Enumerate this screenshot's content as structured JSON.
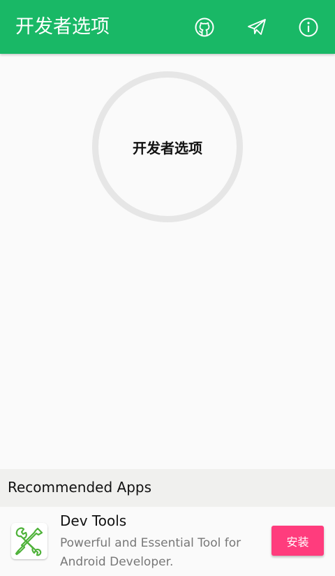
{
  "appbar": {
    "title": "开发者选项",
    "background": "#19b866",
    "actions": [
      {
        "icon": "github-icon"
      },
      {
        "icon": "telegram-send-icon"
      },
      {
        "icon": "info-icon"
      }
    ]
  },
  "main": {
    "circle_label": "开发者选项"
  },
  "recommended": {
    "header": "Recommended Apps",
    "apps": [
      {
        "name": "Dev Tools",
        "description": "Powerful and Essential Tool for Android Developer.",
        "icon": "wrench-screwdriver-icon",
        "install_label": "安装",
        "install_color": "#ff3c7d"
      }
    ]
  }
}
